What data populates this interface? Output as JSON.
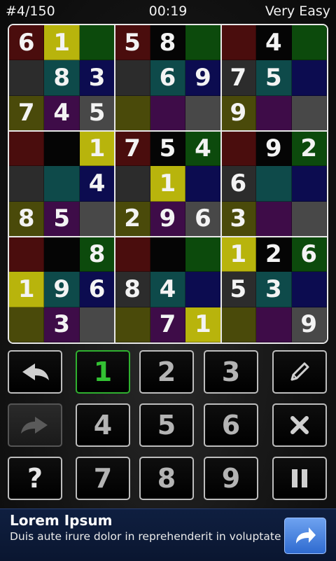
{
  "status": {
    "puzzle_number": "#4/150",
    "timer": "00:19",
    "difficulty": "Very Easy"
  },
  "board": {
    "digits": [
      [
        "6",
        "1",
        "",
        "5",
        "8",
        "",
        "",
        "4",
        ""
      ],
      [
        "",
        "8",
        "3",
        "",
        "6",
        "9",
        "7",
        "5",
        ""
      ],
      [
        "7",
        "4",
        "5",
        "",
        "",
        "",
        "9",
        "",
        ""
      ],
      [
        "",
        "",
        "1",
        "7",
        "5",
        "4",
        "",
        "9",
        "2"
      ],
      [
        "",
        "",
        "4",
        "",
        "1",
        "",
        "6",
        "",
        ""
      ],
      [
        "8",
        "5",
        "",
        "2",
        "9",
        "6",
        "3",
        "",
        ""
      ],
      [
        "",
        "",
        "8",
        "",
        "",
        "",
        "1",
        "2",
        "6"
      ],
      [
        "1",
        "9",
        "6",
        "8",
        "4",
        "",
        "5",
        "3",
        ""
      ],
      [
        "",
        "3",
        "",
        "",
        "7",
        "1",
        "",
        "",
        "9"
      ]
    ],
    "colors": [
      [
        "maroon",
        "yellow",
        "green",
        "maroon",
        "black",
        "green",
        "maroon",
        "black",
        "green"
      ],
      [
        "charcoal",
        "teal",
        "navy",
        "charcoal",
        "teal",
        "navy",
        "charcoal",
        "teal",
        "navy"
      ],
      [
        "olive",
        "purple",
        "gray",
        "olive",
        "purple",
        "gray",
        "olive",
        "purple",
        "gray"
      ],
      [
        "maroon",
        "black",
        "yellow",
        "maroon",
        "black",
        "green",
        "maroon",
        "black",
        "green"
      ],
      [
        "charcoal",
        "teal",
        "navy",
        "charcoal",
        "yellow",
        "navy",
        "charcoal",
        "teal",
        "navy"
      ],
      [
        "olive",
        "purple",
        "gray",
        "olive",
        "purple",
        "gray",
        "olive",
        "purple",
        "gray"
      ],
      [
        "maroon",
        "black",
        "green",
        "maroon",
        "black",
        "green",
        "yellow",
        "black",
        "green"
      ],
      [
        "yellow",
        "teal",
        "navy",
        "charcoal",
        "teal",
        "navy",
        "charcoal",
        "teal",
        "navy"
      ],
      [
        "olive",
        "purple",
        "gray",
        "olive",
        "purple",
        "yellow",
        "olive",
        "purple",
        "gray"
      ]
    ],
    "palette": {
      "maroon": "#4a0d0d",
      "green": "#0c4a0c",
      "black": "#050505",
      "charcoal": "#2c2c2c",
      "teal": "#0e4a4a",
      "navy": "#0c0c50",
      "olive": "#4a4a0a",
      "purple": "#3e0c48",
      "gray": "#484848",
      "yellow": "#b8b40c"
    },
    "border_color": "#e8e8e8"
  },
  "keypad": {
    "keys": [
      {
        "name": "undo-button",
        "label": "",
        "icon": "undo-icon",
        "state": "normal"
      },
      {
        "name": "digit-1-button",
        "label": "1",
        "state": "active"
      },
      {
        "name": "digit-2-button",
        "label": "2",
        "state": "normal"
      },
      {
        "name": "digit-3-button",
        "label": "3",
        "state": "normal"
      },
      {
        "name": "pencil-button",
        "label": "",
        "icon": "pencil-icon",
        "state": "normal"
      },
      {
        "name": "redo-button",
        "label": "",
        "icon": "redo-icon",
        "state": "disabled"
      },
      {
        "name": "digit-4-button",
        "label": "4",
        "state": "normal"
      },
      {
        "name": "digit-5-button",
        "label": "5",
        "state": "normal"
      },
      {
        "name": "digit-6-button",
        "label": "6",
        "state": "normal"
      },
      {
        "name": "erase-button",
        "label": "",
        "icon": "close-icon",
        "state": "normal"
      },
      {
        "name": "hint-button",
        "label": "?",
        "state": "normal"
      },
      {
        "name": "digit-7-button",
        "label": "7",
        "state": "normal"
      },
      {
        "name": "digit-8-button",
        "label": "8",
        "state": "normal"
      },
      {
        "name": "digit-9-button",
        "label": "9",
        "state": "normal"
      },
      {
        "name": "pause-button",
        "label": "",
        "icon": "pause-icon",
        "state": "normal"
      }
    ],
    "accent_color": "#33c233"
  },
  "ad": {
    "title": "Lorem Ipsum",
    "text": "Duis aute irure dolor in reprehenderit in voluptate",
    "button_icon": "share-arrow-icon"
  }
}
